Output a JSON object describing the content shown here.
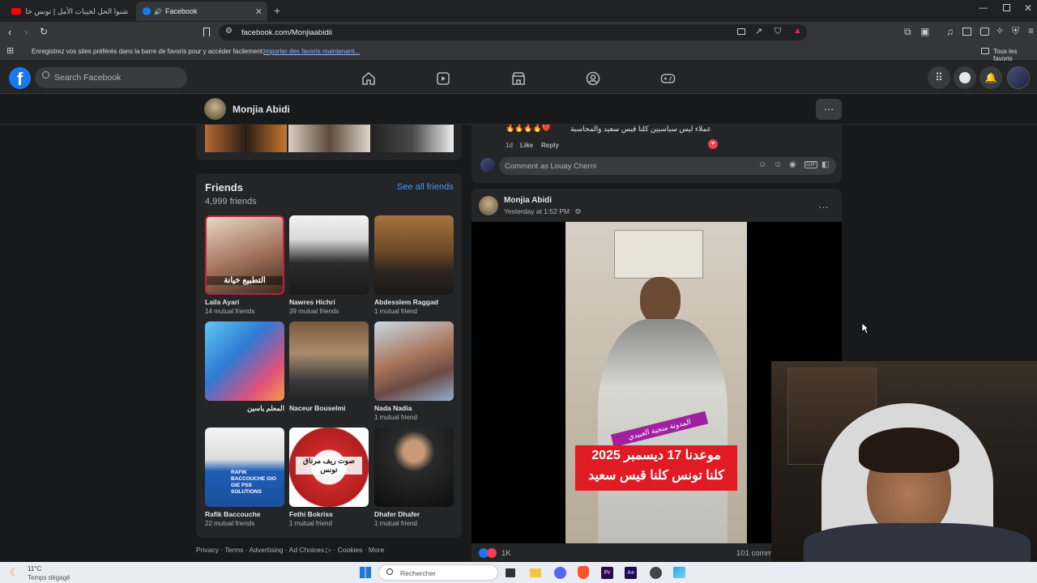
{
  "browser": {
    "tabs": [
      {
        "label": "شنوا الحل لخيبات الأمل | تونس خارج كأ"
      },
      {
        "label": "Facebook"
      }
    ],
    "url": "facebook.com/Monjiaabidii",
    "favbar_text": "Enregistrez vos sites préférés dans la barre de favoris pour y accéder facilement.",
    "favbar_link": "Importer des favoris maintenant...",
    "favbar_all": "Tous les favoris"
  },
  "header": {
    "search_placeholder": "Search Facebook",
    "nav_icons": [
      "home-icon",
      "video-icon",
      "marketplace-icon",
      "groups-icon",
      "gaming-icon"
    ]
  },
  "profile": {
    "name": "Monjia Abidi"
  },
  "friends": {
    "title": "Friends",
    "count": "4,999 friends",
    "see_all": "See all friends",
    "items": [
      {
        "name": "Laila Ayari",
        "mutual": "14 mutual friends",
        "overlay": "التطبيع خيانة"
      },
      {
        "name": "Nawres Hichri",
        "mutual": "39 mutual friends"
      },
      {
        "name": "Abdesslem Raggad",
        "mutual": "1 mutual friend"
      },
      {
        "name": "المعلم ياسين",
        "mutual": ""
      },
      {
        "name": "Naceur Bouselmi",
        "mutual": ""
      },
      {
        "name": "Nada Nadia",
        "mutual": "1 mutual friend"
      },
      {
        "name": "Rafik Baccouche",
        "mutual": "22 mutual friends",
        "overlay": "RAFIK BACCOUCHE GIO GIE PSS SOLUTIONS"
      },
      {
        "name": "Fethi Bokriss",
        "mutual": "1 mutual friend",
        "overlay": "صوت ريف مرناق تونس"
      },
      {
        "name": "Dhafer Dhafer",
        "mutual": "1 mutual friend"
      }
    ]
  },
  "footer_links": {
    "privacy": "Privacy",
    "terms": "Terms",
    "advertising": "Advertising",
    "ad_choices": "Ad Choices",
    "cookies": "Cookies",
    "more": "More"
  },
  "comment": {
    "text": "عملاء ليس سياسيين كلنا قيس سعيد والمحاسبة",
    "time": "1d",
    "like": "Like",
    "reply": "Reply",
    "input_placeholder": "Comment as Louay Cherni"
  },
  "post": {
    "author": "Monjia Abidi",
    "time": "Yesterday at 1:52 PM",
    "video_tag": "المدونة منجية العبيدي",
    "video_caption_1": "موعدنا 17 ديسمبر 2025",
    "video_caption_2": "كلنا تونس كلنا قيس سعيد",
    "reactions_count": "1K",
    "comments_count": "101 comm"
  },
  "taskbar": {
    "temp": "11°C",
    "weather": "Temps dégagé",
    "search": "Rechercher"
  },
  "colors": {
    "fb_blue": "#1877f2",
    "link_blue": "#4599ff",
    "bg": "#18191a",
    "card": "#242526"
  }
}
